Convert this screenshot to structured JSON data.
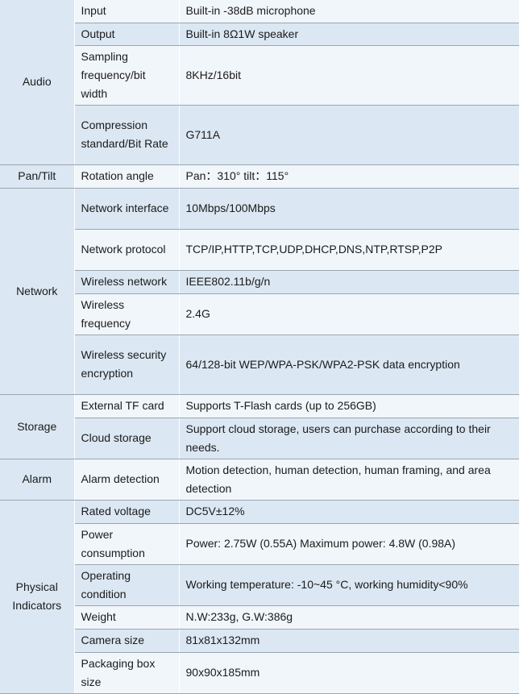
{
  "table": {
    "groups": [
      {
        "category": "Audio",
        "rows": [
          {
            "item": "Input",
            "value": "Built-in -38dB microphone",
            "h": 28
          },
          {
            "item": "Output",
            "value": "Built-in 8Ω1W speaker",
            "h": 28
          },
          {
            "item": "Sampling frequency/bit width",
            "value": "8KHz/16bit",
            "h": 74
          },
          {
            "item": "Compression standard/Bit Rate",
            "value": "G711A",
            "h": 74
          }
        ]
      },
      {
        "category": "Pan/Tilt",
        "rows": [
          {
            "item": "Rotation angle",
            "value": "Pan：310° tilt：115°",
            "h": 29
          }
        ]
      },
      {
        "category": "Network",
        "rows": [
          {
            "item": "Network interface",
            "value": "10Mbps/100Mbps",
            "h": 51
          },
          {
            "item": "Network protocol",
            "value": "TCP/IP,HTTP,TCP,UDP,DHCP,DNS,NTP,RTSP,P2P",
            "h": 51
          },
          {
            "item": "Wireless network",
            "value": "IEEE802.11b/g/n",
            "h": 29
          },
          {
            "item": "Wireless frequency",
            "value": "2.4G",
            "h": 51
          },
          {
            "item": "Wireless security encryption",
            "value": "64/128-bit WEP/WPA-PSK/WPA2-PSK data encryption",
            "h": 74
          }
        ]
      },
      {
        "category": "Storage",
        "rows": [
          {
            "item": "External TF card",
            "value": "Supports T-Flash cards (up to 256GB)",
            "h": 29
          },
          {
            "item": "Cloud storage",
            "value": "Support cloud storage, users can purchase according to their needs.",
            "h": 51
          }
        ]
      },
      {
        "category": "Alarm",
        "rows": [
          {
            "item": "Alarm detection",
            "value": "Motion detection, human detection, human framing, and area detection",
            "h": 51
          }
        ]
      },
      {
        "category": "Physical Indicators",
        "rows": [
          {
            "item": "Rated voltage",
            "value": "DC5V±12%",
            "h": 29
          },
          {
            "item": "Power consumption",
            "value": "Power: 2.75W (0.55A) Maximum power: 4.8W (0.98A)",
            "h": 51
          },
          {
            "item": "Operating condition",
            "value": "Working temperature: -10~45 °C, working humidity<90%",
            "h": 51
          },
          {
            "item": "Weight",
            "value": "N.W:233g, G.W:386g",
            "h": 29
          },
          {
            "item": "Camera size",
            "value": "81x81x132mm",
            "h": 29
          },
          {
            "item": "Packaging box size",
            "value": "90x90x185mm",
            "h": 51
          }
        ]
      }
    ]
  }
}
